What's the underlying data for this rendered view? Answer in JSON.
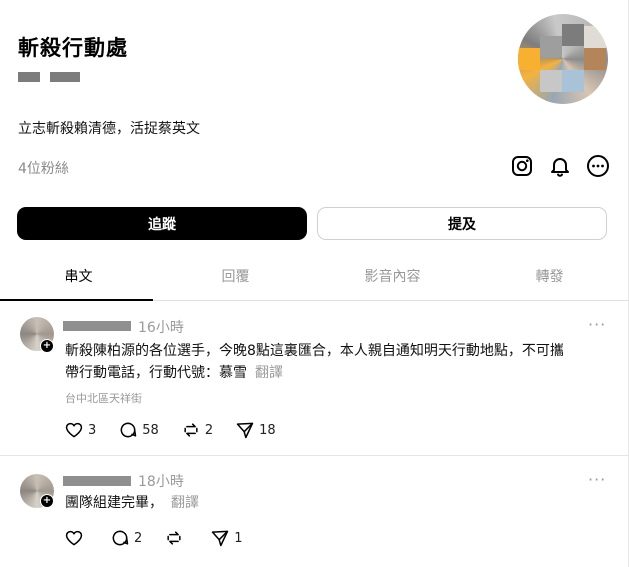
{
  "profile": {
    "name": "斬殺行動處",
    "bio": "立志斬殺賴清德，活捉蔡英文",
    "followers": "4位粉絲"
  },
  "icons": [
    "instagram-icon",
    "bell-icon",
    "more-icon"
  ],
  "buttons": {
    "follow": "追蹤",
    "mention": "提及"
  },
  "tabs": [
    "串文",
    "回覆",
    "影音內容",
    "轉發"
  ],
  "posts": [
    {
      "time": "16小時",
      "text_line1": "斬殺陳柏源的各位選手，今晚8點這裏匯合，本人親自通知明天行動地點，不可攜",
      "text_line2": "帶行動電話，行動代號：慕雪",
      "translate": "翻譯",
      "location": "台中北區天祥街",
      "likes": "3",
      "comments": "58",
      "reposts": "2",
      "shares": "18"
    },
    {
      "time": "18小時",
      "text_line1": "團隊組建完畢，",
      "translate": "翻譯",
      "comments": "2",
      "shares": "1"
    }
  ],
  "more_label": "···",
  "colors": {
    "primary": "#000000",
    "muted": "#999999",
    "divider": "#e6e6e6"
  }
}
